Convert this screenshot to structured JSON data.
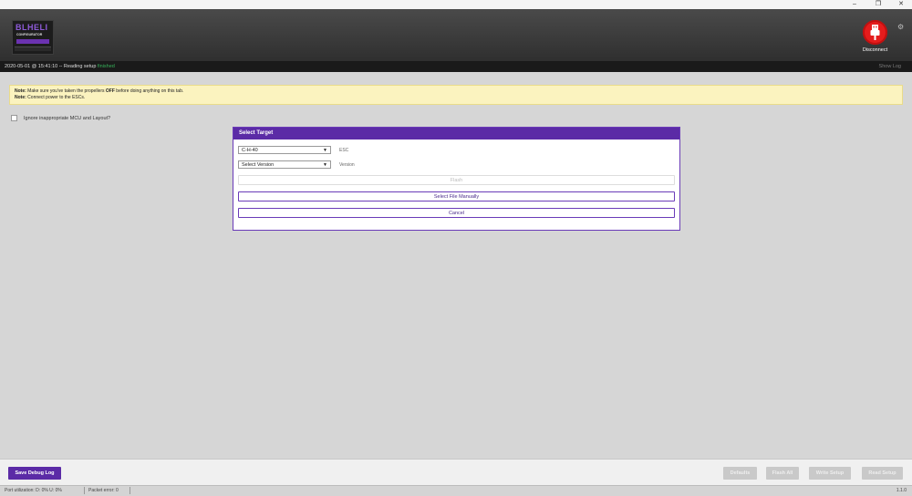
{
  "window": {
    "minimize": "–",
    "maximize": "❐",
    "close": "✕"
  },
  "logo": {
    "title": "BLHELI",
    "subtitle": "CONFIGURATOR",
    "accent_color": "#6b32b0"
  },
  "header": {
    "disconnect_label": "Disconnect",
    "disconnect_color": "#e51c1c",
    "settings_icon": "gear-icon"
  },
  "status": {
    "prefix": "2020-05-01 @ 15:41:10 -- Reading setup",
    "result": "finished",
    "show_log": "Show Log"
  },
  "note": {
    "line1_label": "Note:",
    "line1_pre": "Make sure you've taken the propellers",
    "line1_bold": "OFF",
    "line1_post": "before doing anything on this tab.",
    "line2_label": "Note:",
    "line2_text": "Connect power to the ESCs."
  },
  "options": {
    "ignore_label": "Ignore inappropriate MCU and Layout?"
  },
  "dialog": {
    "title": "Select Target",
    "esc_select": "C-H-40",
    "esc_label": "ESC",
    "version_select": "Select Version",
    "version_label": "Version",
    "flash": "Flash",
    "select_file": "Select File Manually",
    "cancel": "Cancel",
    "accent_color": "#5b2ba6"
  },
  "actions": {
    "save_debug": "Save Debug Log",
    "defaults": "Defaults",
    "flash_all": "Flash All",
    "write_setup": "Write Setup",
    "read_setup": "Read Setup"
  },
  "footer": {
    "port_util": "Port utilization: D: 0% U: 0%",
    "packet_error": "Packet error: 0",
    "version": "1.1.0"
  }
}
